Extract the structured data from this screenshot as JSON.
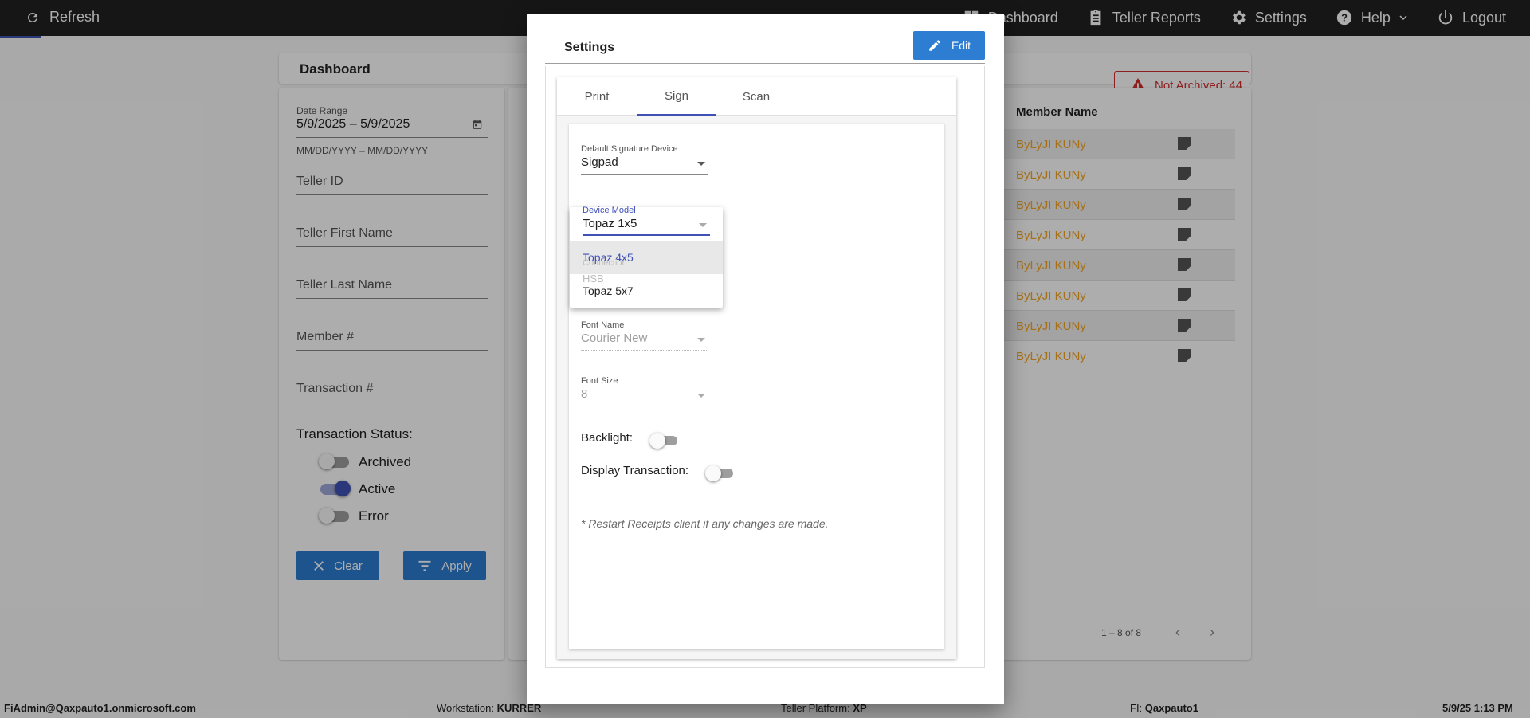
{
  "topbar": {
    "refresh": "Refresh",
    "nav": [
      {
        "label": "Dashboard",
        "icon": "grid-icon"
      },
      {
        "label": "Teller Reports",
        "icon": "clipboard-icon"
      },
      {
        "label": "Settings",
        "icon": "gear-icon"
      },
      {
        "label": "Help",
        "icon": "help-icon"
      },
      {
        "label": "Logout",
        "icon": "power-icon"
      }
    ]
  },
  "dashboard": {
    "title": "Dashboard",
    "not_archived": "Not Archived: 44",
    "filters": {
      "date_range_label": "Date Range",
      "date_range_value": "5/9/2025 – 5/9/2025",
      "date_format_hint": "MM/DD/YYYY – MM/DD/YYYY",
      "teller_id": "Teller ID",
      "teller_first_name": "Teller First Name",
      "teller_last_name": "Teller Last Name",
      "member_num": "Member #",
      "transaction_num": "Transaction #",
      "status_title": "Transaction Status:",
      "statuses": [
        {
          "label": "Archived",
          "on": false
        },
        {
          "label": "Active",
          "on": true
        },
        {
          "label": "Error",
          "on": false
        }
      ],
      "clear": "Clear",
      "apply": "Apply"
    },
    "table": {
      "member_name_header": "Member Name",
      "rows": [
        "ByLyJI KUNy",
        "ByLyJI KUNy",
        "ByLyJI KUNy",
        "ByLyJI KUNy",
        "ByLyJI KUNy",
        "ByLyJI KUNy",
        "ByLyJI KUNy",
        "ByLyJI KUNy"
      ],
      "pager": "1 – 8 of 8"
    }
  },
  "modal": {
    "title": "Settings",
    "edit": "Edit",
    "tabs": [
      "Print",
      "Sign",
      "Scan"
    ],
    "active_tab": "Sign",
    "default_signature_device_label": "Default Signature Device",
    "default_signature_device": "Sigpad",
    "device_model_label": "Device Model",
    "device_model": "Topaz 1x5",
    "device_model_options": [
      "Topaz 4x5",
      "Topaz 5x7"
    ],
    "highlighted_option": "Topaz 4x5",
    "connection_label": "Connection",
    "connection": "HSB",
    "font_name_label": "Font Name",
    "font_name": "Courier New",
    "font_size_label": "Font Size",
    "font_size": "8",
    "backlight_label": "Backlight:",
    "display_transaction_label": "Display Transaction:",
    "note": "* Restart Receipts client if any changes are made."
  },
  "statusbar": {
    "user": "FiAdmin@Qaxpauto1.onmicrosoft.com",
    "workstation_label": "Workstation:",
    "workstation": "KURRER",
    "platform_label": "Teller Platform:",
    "platform": "XP",
    "fi_label": "FI:",
    "fi": "Qaxpauto1",
    "datetime": "5/9/25 1:13 PM"
  },
  "colors": {
    "accent": "#3f51b5",
    "button": "#2d7dd2",
    "link_orange": "#f5a623",
    "error": "#d32f2f"
  }
}
